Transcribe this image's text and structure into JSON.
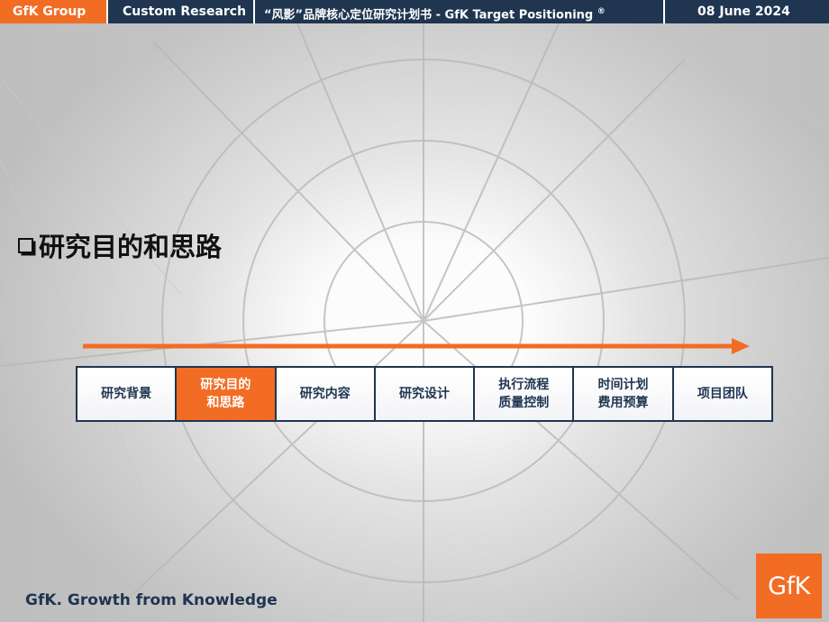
{
  "header": {
    "group": "GfK Group",
    "division": "Custom Research",
    "title": "“风影”品牌核心定位研究计划书 - GfK Target Positioning",
    "title_mark": "®",
    "date": "08 June 2024"
  },
  "section": {
    "heading": "研究目的和思路"
  },
  "steps": [
    {
      "label": "研究背景",
      "active": false
    },
    {
      "label": "研究目的\n和思路",
      "active": true
    },
    {
      "label": "研究内容",
      "active": false
    },
    {
      "label": "研究设计",
      "active": false
    },
    {
      "label": "执行流程\n质量控制",
      "active": false
    },
    {
      "label": "时间计划\n费用预算",
      "active": false
    },
    {
      "label": "项目团队",
      "active": false
    }
  ],
  "footer": {
    "tagline": "GfK. Growth from Knowledge",
    "logo_text": "GfK"
  },
  "colors": {
    "accent": "#f26c23",
    "navy": "#1f3550"
  }
}
